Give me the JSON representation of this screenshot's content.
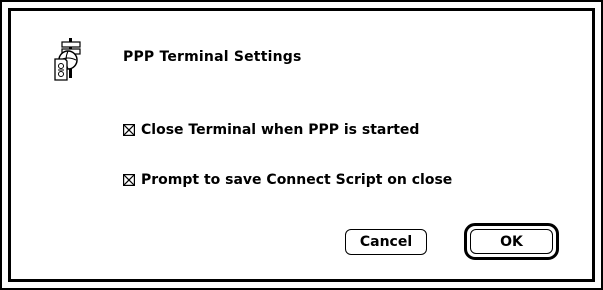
{
  "dialog": {
    "title": "PPP Terminal Settings",
    "icon": "ppp-terminal-icon",
    "options": [
      {
        "label": "Close Terminal when PPP is started",
        "checked": true
      },
      {
        "label": "Prompt to save Connect Script on close",
        "checked": true
      }
    ],
    "buttons": {
      "cancel_label": "Cancel",
      "ok_label": "OK",
      "default": "OK"
    }
  }
}
